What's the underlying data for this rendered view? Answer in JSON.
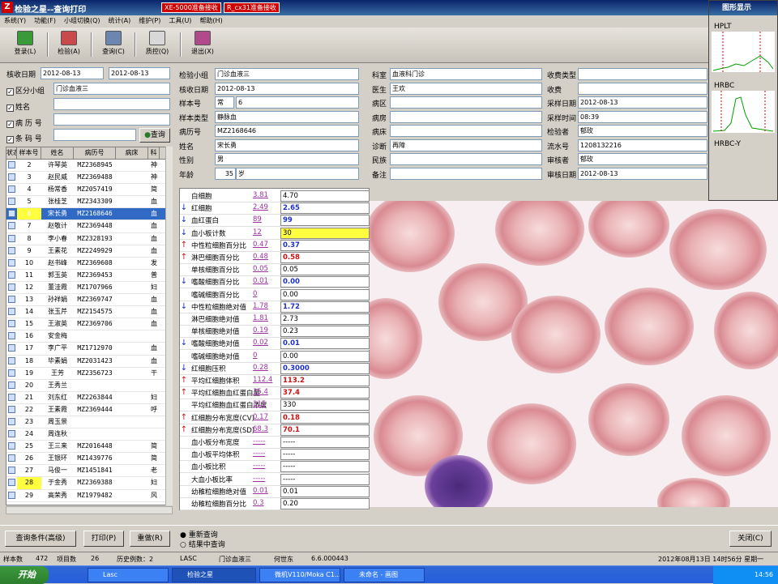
{
  "window": {
    "title": "检验之星--查询打印",
    "badge1": "XE-5000准备接收",
    "badge2": "R_cx31准备接收"
  },
  "menu": [
    "系统(Y)",
    "功能(F)",
    "小组切换(Q)",
    "统计(A)",
    "维护(P)",
    "工具(U)",
    "帮助(H)"
  ],
  "toolbar": [
    "登录(L)",
    "检验(A)",
    "查询(C)",
    "质控(Q)",
    "退出(X)"
  ],
  "filter": {
    "date_label": "核收日期",
    "date_from": "2012-08-13",
    "date_to": "2012-08-13",
    "group_label": "区分小组",
    "group_value": "门诊血液三",
    "name_label": "姓名",
    "record_label": "病 历 号",
    "barcode_label": "条 码 号",
    "query_btn": "查询"
  },
  "grid": {
    "headers": [
      "状态",
      "样本号",
      "姓名",
      "病历号",
      "病床",
      "科"
    ],
    "rows": [
      {
        "no": "2",
        "name": "许琴英",
        "rec": "MZ2368945",
        "bed": "",
        "dep": "神"
      },
      {
        "no": "3",
        "name": "赵民威",
        "rec": "MZ2369488",
        "bed": "",
        "dep": "神"
      },
      {
        "no": "4",
        "name": "杨常香",
        "rec": "MZ2057419",
        "bed": "",
        "dep": "简"
      },
      {
        "no": "5",
        "name": "张桂芝",
        "rec": "MZ2343309",
        "bed": "",
        "dep": "血"
      },
      {
        "no": "6",
        "name": "宋长勇",
        "rec": "MZ2168646",
        "bed": "",
        "dep": "血"
      },
      {
        "no": "7",
        "name": "赵敬计",
        "rec": "MZ2369448",
        "bed": "",
        "dep": "血"
      },
      {
        "no": "8",
        "name": "李小春",
        "rec": "MZ2328193",
        "bed": "",
        "dep": "血"
      },
      {
        "no": "9",
        "name": "王素花",
        "rec": "MZ2249929",
        "bed": "",
        "dep": "血"
      },
      {
        "no": "10",
        "name": "赵书峰",
        "rec": "MZ2369608",
        "bed": "",
        "dep": "发"
      },
      {
        "no": "11",
        "name": "郭玉英",
        "rec": "MZ2369453",
        "bed": "",
        "dep": "普"
      },
      {
        "no": "12",
        "name": "董洼霞",
        "rec": "MZ1707966",
        "bed": "",
        "dep": "妇"
      },
      {
        "no": "13",
        "name": "孙祥娟",
        "rec": "MZ2369747",
        "bed": "",
        "dep": "血"
      },
      {
        "no": "14",
        "name": "张玉芹",
        "rec": "MZ2154575",
        "bed": "",
        "dep": "血"
      },
      {
        "no": "15",
        "name": "王淑英",
        "rec": "MZ2369706",
        "bed": "",
        "dep": "血"
      },
      {
        "no": "16",
        "name": "安金梅",
        "rec": "",
        "bed": "",
        "dep": ""
      },
      {
        "no": "17",
        "name": "李广平",
        "rec": "MZ1712970",
        "bed": "",
        "dep": "血"
      },
      {
        "no": "18",
        "name": "毕素娟",
        "rec": "MZ2031423",
        "bed": "",
        "dep": "血"
      },
      {
        "no": "19",
        "name": "王芳",
        "rec": "MZ2356723",
        "bed": "",
        "dep": "干"
      },
      {
        "no": "20",
        "name": "王秀兰",
        "rec": "",
        "bed": "",
        "dep": ""
      },
      {
        "no": "21",
        "name": "刘东红",
        "rec": "MZ2263844",
        "bed": "",
        "dep": "妇"
      },
      {
        "no": "22",
        "name": "王素霞",
        "rec": "MZ2369444",
        "bed": "",
        "dep": "呼"
      },
      {
        "no": "23",
        "name": "周玉景",
        "rec": "",
        "bed": "",
        "dep": ""
      },
      {
        "no": "24",
        "name": "周连秋",
        "rec": "",
        "bed": "",
        "dep": ""
      },
      {
        "no": "25",
        "name": "王三来",
        "rec": "MZ2016448",
        "bed": "",
        "dep": "简"
      },
      {
        "no": "26",
        "name": "王银环",
        "rec": "MZ1439776",
        "bed": "",
        "dep": "简"
      },
      {
        "no": "27",
        "name": "马俊一",
        "rec": "MZ1451841",
        "bed": "",
        "dep": "老"
      },
      {
        "no": "28",
        "name": "于金秀",
        "rec": "MZ2369388",
        "bed": "",
        "dep": "妇"
      },
      {
        "no": "29",
        "name": "高荣秀",
        "rec": "MZ1979482",
        "bed": "",
        "dep": "风"
      }
    ]
  },
  "info": {
    "c1": [
      [
        "检验小组",
        "门诊血液三"
      ],
      [
        "核收日期",
        "2012-08-13"
      ],
      [
        "样本号",
        "常",
        ""
      ],
      [
        "样本类型",
        "静脉血"
      ],
      [
        "病历号",
        "MZ2168646"
      ],
      [
        "姓名",
        "宋长勇"
      ],
      [
        "性别",
        "男"
      ],
      [
        "年龄",
        "35",
        "岁"
      ]
    ],
    "sample_no": "6",
    "c2": [
      [
        "科室",
        "血液科门诊"
      ],
      [
        "医生",
        "王欢"
      ],
      [
        "病区",
        ""
      ],
      [
        "病房",
        ""
      ],
      [
        "病床",
        ""
      ],
      [
        "诊断",
        "再障"
      ],
      [
        "民族",
        ""
      ],
      [
        "备注",
        ""
      ]
    ],
    "c3": [
      [
        "收费类型",
        ""
      ],
      [
        "收费",
        ""
      ],
      [
        "采样日期",
        "2012-08-13"
      ],
      [
        "采样时间",
        "08:39"
      ],
      [
        "检验者",
        "郁玫"
      ],
      [
        "流水号",
        "1208132216"
      ],
      [
        "审核者",
        "郁玫"
      ],
      [
        "审核日期",
        "2012-08-13"
      ]
    ]
  },
  "results": [
    {
      "dir": "",
      "name": "白细胞",
      "prev": "3.81",
      "cur": "4.70",
      "flag": ""
    },
    {
      "dir": "↓",
      "name": "红细胞",
      "prev": "2.49",
      "cur": "2.65",
      "flag": "low"
    },
    {
      "dir": "↓",
      "name": "血红蛋白",
      "prev": "89",
      "cur": "99",
      "flag": "low"
    },
    {
      "dir": "↓",
      "name": "血小板计数",
      "prev": "12",
      "cur": "30",
      "flag": "crit"
    },
    {
      "dir": "↑",
      "name": "中性粒细胞百分比",
      "prev": "0.47",
      "cur": "0.37",
      "flag": "low"
    },
    {
      "dir": "↑",
      "name": "淋巴细胞百分比",
      "prev": "0.48",
      "cur": "0.58",
      "flag": "high"
    },
    {
      "dir": "",
      "name": "单核细胞百分比",
      "prev": "0.05",
      "cur": "0.05",
      "flag": ""
    },
    {
      "dir": "↓",
      "name": "嗜酸细胞百分比",
      "prev": "0.01",
      "cur": "0.00",
      "flag": "low"
    },
    {
      "dir": "",
      "name": "嗜碱细胞百分比",
      "prev": "0",
      "cur": "0.00",
      "flag": ""
    },
    {
      "dir": "↓",
      "name": "中性粒细胞绝对值",
      "prev": "1.78",
      "cur": "1.72",
      "flag": "low"
    },
    {
      "dir": "",
      "name": "淋巴细胞绝对值",
      "prev": "1.81",
      "cur": "2.73",
      "flag": ""
    },
    {
      "dir": "",
      "name": "单核细胞绝对值",
      "prev": "0.19",
      "cur": "0.23",
      "flag": ""
    },
    {
      "dir": "↓",
      "name": "嗜酸细胞绝对值",
      "prev": "0.02",
      "cur": "0.01",
      "flag": "low"
    },
    {
      "dir": "",
      "name": "嗜碱细胞绝对值",
      "prev": "0",
      "cur": "0.00",
      "flag": ""
    },
    {
      "dir": "↓",
      "name": "红细胞压积",
      "prev": "0.28",
      "cur": "0.3000",
      "flag": "low"
    },
    {
      "dir": "↑",
      "name": "平均红细胞体积",
      "prev": "112.4",
      "cur": "113.2",
      "flag": "high"
    },
    {
      "dir": "↑",
      "name": "平均红细胞血红蛋白量",
      "prev": "35.4",
      "cur": "37.4",
      "flag": "high"
    },
    {
      "dir": "",
      "name": "平均红细胞血红蛋白浓度",
      "prev": "315",
      "cur": "330",
      "flag": ""
    },
    {
      "dir": "↑",
      "name": "红细胞分布宽度(CV)",
      "prev": "0.17",
      "cur": "0.18",
      "flag": "high"
    },
    {
      "dir": "↑",
      "name": "红细胞分布宽度(SD)",
      "prev": "68.3",
      "cur": "70.1",
      "flag": "high"
    },
    {
      "dir": "",
      "name": "血小板分布宽度",
      "prev": "-----",
      "cur": "-----",
      "flag": ""
    },
    {
      "dir": "",
      "name": "血小板平均体积",
      "prev": "-----",
      "cur": "-----",
      "flag": ""
    },
    {
      "dir": "",
      "name": "血小板比积",
      "prev": "-----",
      "cur": "-----",
      "flag": ""
    },
    {
      "dir": "",
      "name": "大血小板比率",
      "prev": "-----",
      "cur": "-----",
      "flag": ""
    },
    {
      "dir": "",
      "name": "幼稚粒细胞绝对值",
      "prev": "0.01",
      "cur": "0.01",
      "flag": ""
    },
    {
      "dir": "",
      "name": "幼稚粒细胞百分比",
      "prev": "0.3",
      "cur": "0.20",
      "flag": ""
    }
  ],
  "graph": {
    "title": "图形显示",
    "labels": [
      "HPLT",
      "HRBC",
      "HRBC-Y"
    ]
  },
  "bottom": {
    "btn_cond": "查询条件(高级)",
    "btn_print": "打印(P)",
    "btn_retry": "重做(R)",
    "radio1": "重新查询",
    "radio2": "结果中查询",
    "btn_close": "关闭(C)"
  },
  "status": {
    "sample_label": "样本数",
    "sample_count": "472",
    "item_label": "项目数",
    "item_count": "26",
    "hist_label": "历史例数：2",
    "s1": "LASC",
    "s2": "门诊血液三",
    "s3": "何世东",
    "s4": "6.6.000443",
    "s5": "2012年08月13日 14时56分 星期一"
  },
  "taskbar": {
    "start": "开始",
    "tasks": [
      "Lasc",
      "检验之星",
      "微机V110/Moka C1...",
      "未命名 - 画图"
    ],
    "time": "14:56"
  },
  "colors": {
    "title": "#0a246a",
    "select": "#316ac5",
    "yellow": "#ffff40",
    "low": "#1a2fd0",
    "high": "#d01010"
  }
}
